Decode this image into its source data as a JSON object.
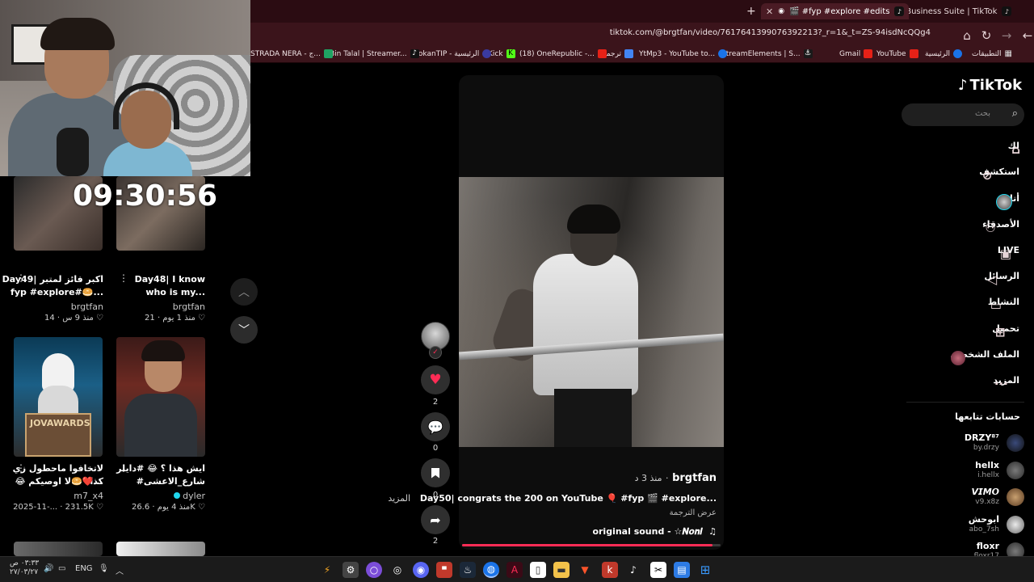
{
  "browser": {
    "tabs": [
      {
        "label": "🎬 #fyp #explore #edits",
        "active": true
      },
      {
        "label": "Business Suite | TikTok",
        "active": false
      }
    ],
    "new_tab": "+",
    "url": "tiktok.com/@brgtfan/video/7617641399076392213?_r=1&_t=ZS-94isdNcQQg4",
    "bookmarks": [
      "التطبيقات",
      "الرئيسية",
      "YouTube",
      "Gmail",
      "StreamElements | S...",
      "YtMp3 - YouTube to...",
      "ترجمة",
      "(18) OneRepublic -...",
      "Kick",
      "DokanTIP - الرئيسية",
      "Bin Talal | Streamer...",
      "STRADA NERA - ج..."
    ]
  },
  "overlay": {
    "clock": "09:30:56"
  },
  "grid": [
    {
      "title_line1": "Day49| اكبر فائز لمتبر",
      "title_line2": "fyp #explore#🥯...",
      "author": "brgtfan",
      "likes": "14",
      "age": "منذ 9 س"
    },
    {
      "title_line1": "Day48| I know",
      "title_line2": "who is my...",
      "author": "brgtfan",
      "likes": "21",
      "age": "منذ 1 يوم"
    },
    {
      "title_line1": "لاتخافوا ماحطول زي كذا",
      "title_line2": "😂 لا اوصيكم🥯❤️...",
      "author": "m7_x4",
      "likes": "231.5K",
      "age": "2025-11-..."
    },
    {
      "title_line1": "ايش هذا ؟ 😂 #دايلر",
      "title_line2": "#شارع_الاعشى",
      "author": "dyler",
      "likes": "26.6K",
      "age": "منذ 4 يوم"
    }
  ],
  "thumb_text": {
    "jov_awards": "JOVAWARDS"
  },
  "video": {
    "author": "brgtfan",
    "age": "منذ 3 د",
    "caption": "Day50| congrats the 200 on YouTube 🎈 #fyp 🎬 #explore...",
    "more": "المزيد",
    "translate": "عرض الترجمة",
    "sound": "original sound - ☆𝑵𝒐𝒏𝒊",
    "progress": 0.97,
    "actions": {
      "likes": "2",
      "comments": "0",
      "saves": "0",
      "shares": "2"
    }
  },
  "sidebar": {
    "logo": "TikTok",
    "search_placeholder": "بحث",
    "nav": [
      {
        "label": "لك",
        "icon": "home-icon"
      },
      {
        "label": "استكشف",
        "icon": "compass-icon"
      },
      {
        "label": "أتابعه",
        "icon": "avatar-icon"
      },
      {
        "label": "الأصدقاء",
        "icon": "friends-icon"
      },
      {
        "label": "LIVE",
        "icon": "live-icon"
      },
      {
        "label": "الرسائل",
        "icon": "send-icon"
      },
      {
        "label": "النشاط",
        "icon": "activity-icon"
      },
      {
        "label": "تحميل",
        "icon": "upload-icon"
      },
      {
        "label": "الملف الشخصي",
        "icon": "profile-icon"
      },
      {
        "label": "المزيد",
        "icon": "more-icon"
      }
    ],
    "following_header": "حسابات تتابعها",
    "following": [
      {
        "name": "DRZY⁸⁷",
        "handle": "by.drzy"
      },
      {
        "name": "hellx",
        "handle": "i.hellx"
      },
      {
        "name": "𝙑𝙄𝙈𝙊",
        "handle": "v9.x8z"
      },
      {
        "name": "ابوحش",
        "handle": "abo_7sh"
      },
      {
        "name": "floxr",
        "handle": "floxr17"
      }
    ]
  },
  "taskbar": {
    "time": "٠٣:٣٣ ص",
    "date": "٢٧/٠٣/٢٧",
    "lang": "ENG"
  },
  "colors": {
    "accent": "#fe2c55",
    "chrome": "#3b141b"
  }
}
